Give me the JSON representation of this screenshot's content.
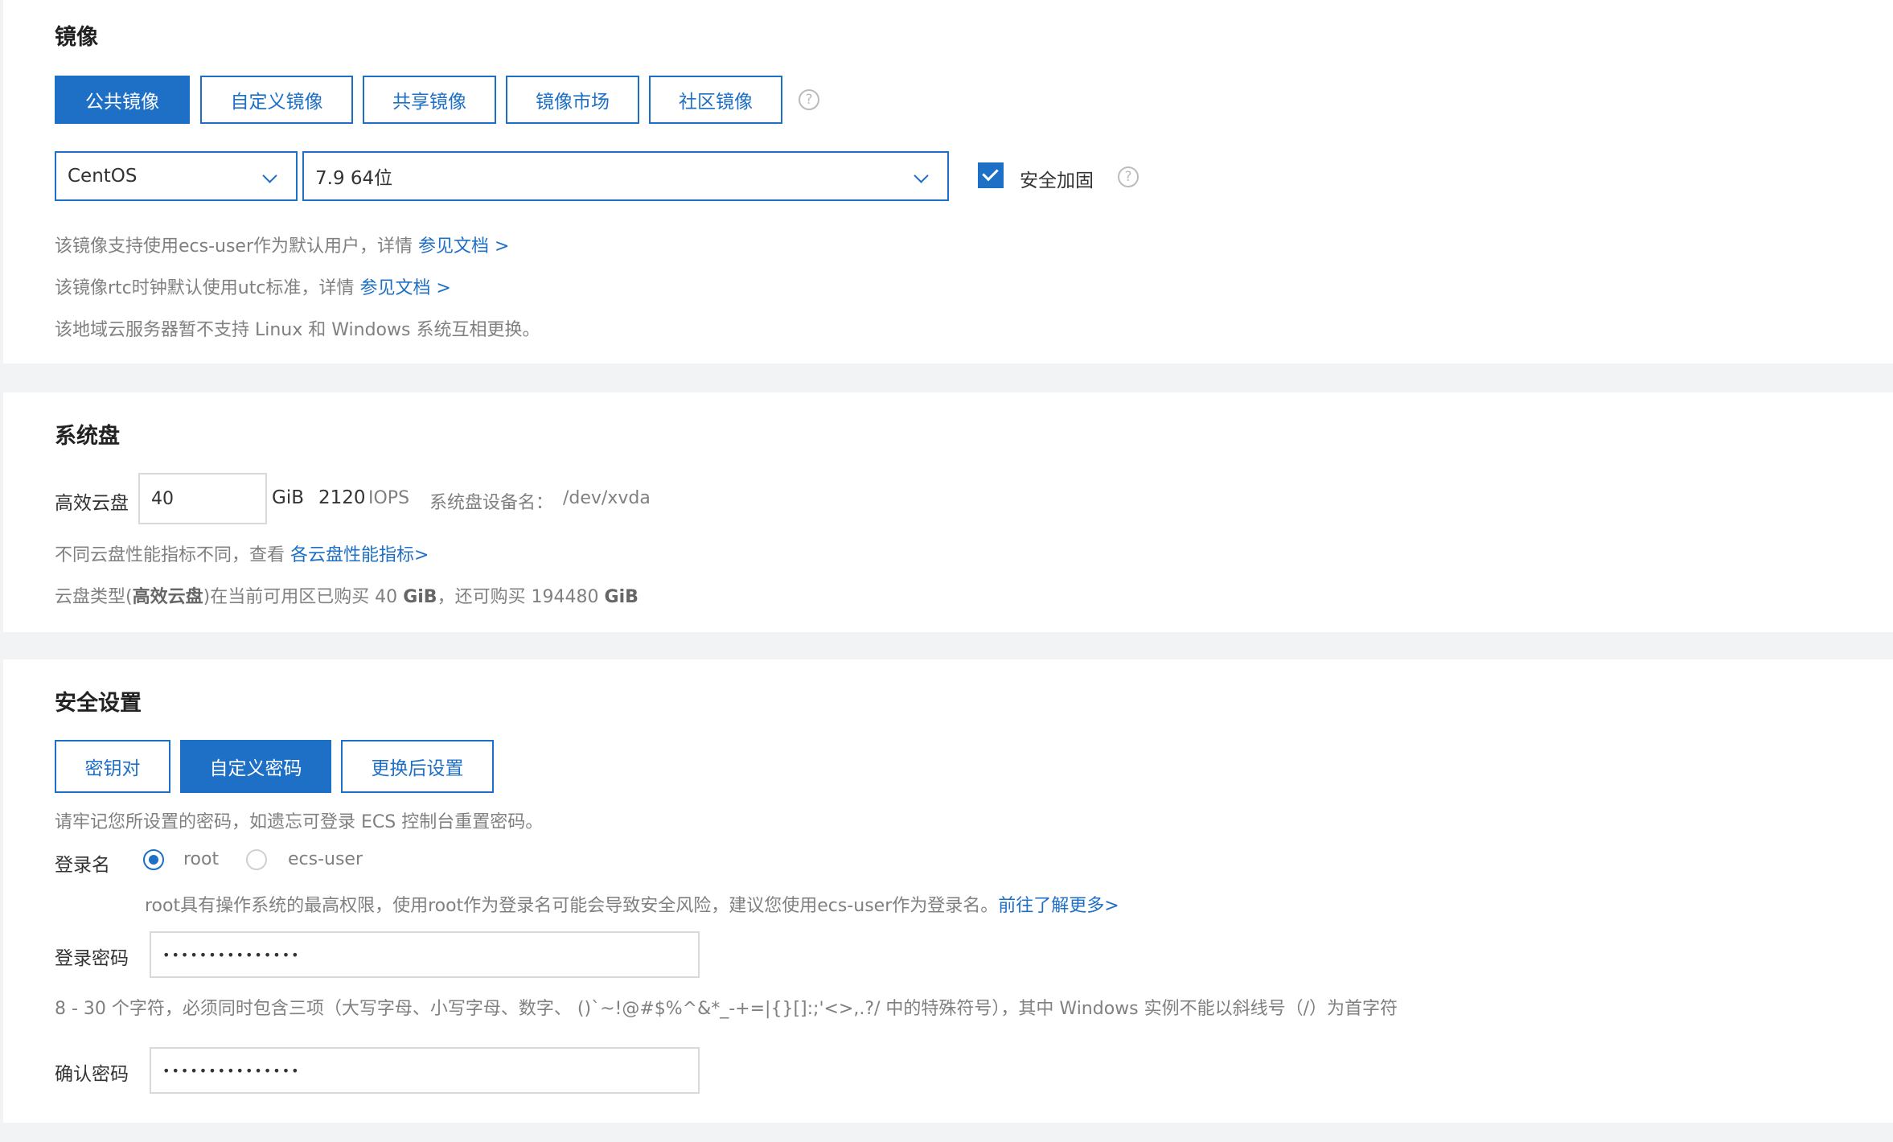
{
  "image_section": {
    "title": "镜像",
    "tabs": [
      "公共镜像",
      "自定义镜像",
      "共享镜像",
      "镜像市场",
      "社区镜像"
    ],
    "active_tab": 0,
    "os_select": "CentOS",
    "version_select": "7.9 64位",
    "security_hardening_label": "安全加固",
    "security_hardening_checked": true,
    "hint1_text": "该镜像支持使用ecs-user作为默认用户，详情 ",
    "hint1_link": "参见文档 >",
    "hint2_text": "该镜像rtc时钟默认使用utc标准，详情 ",
    "hint2_link": "参见文档 >",
    "hint3_text": "该地域云服务器暂不支持 Linux 和 Windows 系统互相更换。"
  },
  "disk_section": {
    "title": "系统盘",
    "disk_type": "高效云盘",
    "size_value": "40",
    "size_unit": "GiB",
    "iops_value": "2120",
    "iops_unit": "IOPS",
    "device_label": "系统盘设备名：",
    "device_name": "/dev/xvda",
    "perf_hint_text": "不同云盘性能指标不同，查看 ",
    "perf_hint_link": "各云盘性能指标>",
    "quota_prefix": "云盘类型(",
    "quota_type": "高效云盘",
    "quota_mid": ")在当前可用区已购买 40 ",
    "quota_unit1": "GiB",
    "quota_mid2": "，还可购买 194480 ",
    "quota_unit2": "GiB"
  },
  "security_section": {
    "title": "安全设置",
    "tabs": [
      "密钥对",
      "自定义密码",
      "更换后设置"
    ],
    "active_tab": 1,
    "remember_hint": "请牢记您所设置的密码，如遗忘可登录 ECS 控制台重置密码。",
    "login_name_label": "登录名",
    "login_options": [
      "root",
      "ecs-user"
    ],
    "login_selected": 0,
    "root_warning_text": "root具有操作系统的最高权限，使用root作为登录名可能会导致安全风险，建议您使用ecs-user作为登录名。",
    "root_warning_link": "前往了解更多>",
    "password_label": "登录密码",
    "password_value": "•••••••••••••••",
    "password_rule": "8 - 30 个字符，必须同时包含三项（大写字母、小写字母、数字、 ()`~!@#$%^&*_-+=|{}[]:;'<>,.?/ 中的特殊符号），其中 Windows 实例不能以斜线号（/）为首字符",
    "confirm_label": "确认密码",
    "confirm_value": "•••••••••••••••"
  }
}
